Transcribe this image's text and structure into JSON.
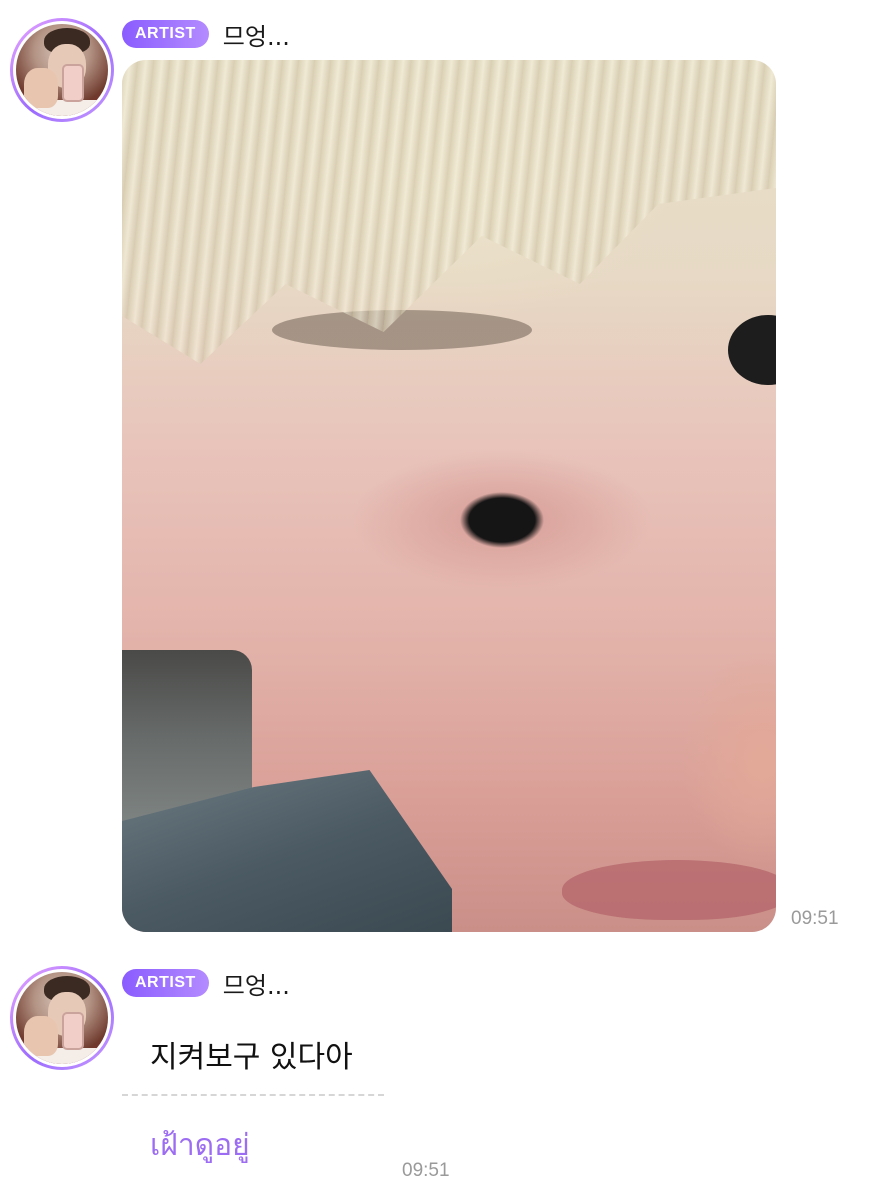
{
  "messages": [
    {
      "badge": "ARTIST",
      "sender": "므엉...",
      "type": "photo",
      "time": "09:51"
    },
    {
      "badge": "ARTIST",
      "sender": "므엉...",
      "type": "text",
      "text": "지켜보구 있다아",
      "translation": "เฝ้าดูอยู่",
      "time": "09:51"
    }
  ],
  "colors": {
    "badge_start": "#8a5cff",
    "badge_end": "#b48bff",
    "translation": "#9c6cf2",
    "timestamp": "#9a9a9a"
  }
}
